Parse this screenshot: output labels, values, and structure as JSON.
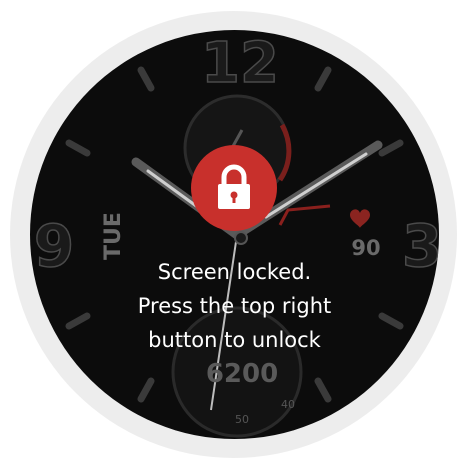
{
  "watch_face": {
    "hour_twelve": "12",
    "hour_nine": "9",
    "hour_three": "3",
    "weekday": "TUE",
    "heart_rate": "90",
    "steps": "6200",
    "dial_numbers": [
      "50",
      "40"
    ]
  },
  "lock_overlay": {
    "icon": "lock-icon",
    "message_lines": [
      "Screen locked.",
      "Press the top right",
      "button to unlock"
    ]
  },
  "colors": {
    "accent_red": "#c8302c",
    "screen": "#0c0c0c",
    "bezel": "#ededed"
  }
}
